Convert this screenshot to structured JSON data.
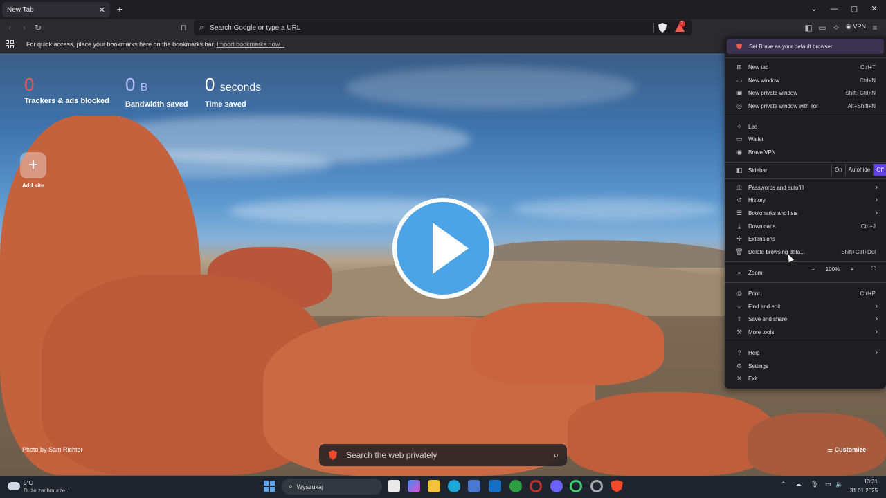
{
  "browser": {
    "tab_title": "New Tab",
    "address_placeholder": "Search Google or type a URL",
    "vpn_label": "VPN",
    "rewards_badge": "1"
  },
  "bookmarks_bar": {
    "message": "For quick access, place your bookmarks here on the bookmarks bar.",
    "import_link": "Import bookmarks now..."
  },
  "stats": {
    "trackers_value": "0",
    "trackers_label": "Trackers & ads blocked",
    "bandwidth_value": "0",
    "bandwidth_unit": "B",
    "bandwidth_label": "Bandwidth saved",
    "time_value": "0",
    "time_unit": "seconds",
    "time_label": "Time saved"
  },
  "top_sites": {
    "add_label": "Add site"
  },
  "photo_credit": "Photo by Sam Richter",
  "customize_label": "Customize",
  "ntp_search": {
    "placeholder": "Search the web privately"
  },
  "menu": {
    "banner": "Set Brave as your default browser",
    "new_tab": {
      "label": "New tab",
      "shortcut": "Ctrl+T"
    },
    "new_window": {
      "label": "New window",
      "shortcut": "Ctrl+N"
    },
    "new_private_window": {
      "label": "New private window",
      "shortcut": "Shift+Ctrl+N"
    },
    "new_private_tor": {
      "label": "New private window with Tor",
      "shortcut": "Alt+Shift+N"
    },
    "leo": "Leo",
    "wallet": "Wallet",
    "brave_vpn": "Brave VPN",
    "sidebar": {
      "label": "Sidebar",
      "options": [
        "On",
        "Autohide",
        "Off"
      ],
      "selected": "Off"
    },
    "passwords": "Passwords and autofill",
    "history": "History",
    "bookmarks": "Bookmarks and lists",
    "downloads": {
      "label": "Downloads",
      "shortcut": "Ctrl+J"
    },
    "extensions": "Extensions",
    "delete_data": {
      "label": "Delete browsing data...",
      "shortcut": "Shift+Ctrl+Del"
    },
    "zoom": {
      "label": "Zoom",
      "minus": "−",
      "value": "100%",
      "plus": "+"
    },
    "print": {
      "label": "Print...",
      "shortcut": "Ctrl+P"
    },
    "find_edit": "Find and edit",
    "save_share": "Save and share",
    "more_tools": "More tools",
    "help": "Help",
    "settings": "Settings",
    "exit": "Exit"
  },
  "taskbar": {
    "temperature": "9°C",
    "weather": "Duże zachmurze...",
    "search_placeholder": "Wyszukaj",
    "time": "13:31",
    "date": "31.01.2025"
  },
  "colors": {
    "accent": "#5b3fe0",
    "tracker_count": "#f05a4f",
    "bandwidth_count": "#b3b8ff",
    "play_button": "#4ca4e6"
  }
}
